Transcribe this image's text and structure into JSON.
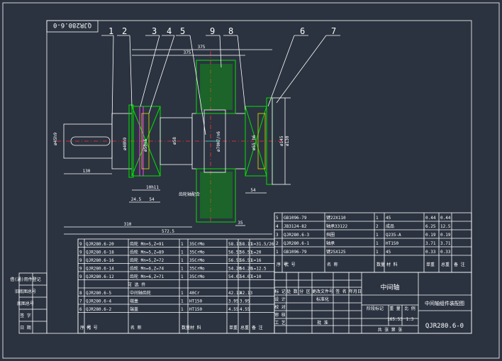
{
  "drawing_code_flipped": "QJR280.6-0",
  "drawing_code": "QJR280.6-0",
  "balloons": [
    "1",
    "2",
    "3",
    "4",
    "5",
    "9",
    "8",
    "6",
    "7"
  ],
  "dimensions": {
    "d_shaft_left": "ø45h9",
    "d_bearing_left": "ø40h9",
    "d_seal_left": "ø50n6",
    "d_journal_left": "ø58",
    "d_gear_bore": "ø70H7/n6",
    "d_bearing_right": "ø55 h6",
    "d_right_1": "ø145",
    "d_right_2": "ø130",
    "len_130": "130",
    "len_24_5": "24.5",
    "len_54": "54",
    "len_10": "10",
    "len_35": "35",
    "len_54b": "54",
    "len_310": "310",
    "len_572_5": "572.5",
    "len_375": "375",
    "len_375b": "375",
    "note_left": "10h11",
    "note_center": "齿轮轴配合"
  },
  "parts_upper": [
    {
      "no": "5",
      "code": "GB1096-79",
      "name": "键22X110",
      "qty": "1",
      "mat": "45",
      "w1": "0.44",
      "w2": "0.44"
    },
    {
      "no": "4",
      "code": "JB3124-82",
      "name": "轴承33122",
      "qty": "2",
      "mat": "成品",
      "w1": "6.25",
      "w2": "12.5"
    },
    {
      "no": "3",
      "code": "QJR280.6-3",
      "name": "挡圈",
      "qty": "1",
      "mat": "Q235-A",
      "w1": "0.19",
      "w2": "0.19"
    },
    {
      "no": "2",
      "code": "QJR280.6-1",
      "name": "轴承",
      "qty": "1",
      "mat": "HT150",
      "w1": "3.71",
      "w2": "3.71"
    },
    {
      "no": "1",
      "code": "GB1096-79",
      "name": "键25X125",
      "qty": "1",
      "mat": "45",
      "w1": "0.33",
      "w2": "0.33"
    }
  ],
  "parts_lower": [
    {
      "no": "9",
      "code": "QJR280.6-20",
      "name": "齿轮 Mn=5,Z=91",
      "qty": "1",
      "mat": "35CrMo",
      "w1": "58.11",
      "w2": "58.11",
      "note": "i=31.5/26"
    },
    {
      "no": "9",
      "code": "QJR280.6-18",
      "name": "齿轮 Mn=5,Z=89",
      "qty": "1",
      "mat": "35CrMo",
      "w1": "56.51",
      "w2": "56.51",
      "note": "i=20"
    },
    {
      "no": "9",
      "code": "QJR280.6-16",
      "name": "齿轮 Mn=5,Z=72",
      "qty": "1",
      "mat": "35CrMo",
      "w1": "56.51",
      "w2": "56.51",
      "note": "i=16"
    },
    {
      "no": "9",
      "code": "QJR280.6-14",
      "name": "齿轮 Mn=6,Z=74",
      "qty": "1",
      "mat": "35CrMo",
      "w1": "54.20",
      "w2": "54.20",
      "note": "i=12.5"
    },
    {
      "no": "9",
      "code": "QJR280.6-12",
      "name": "齿轮 Mn=6,Z=71",
      "qty": "1",
      "mat": "35CrMo",
      "w1": "54.07",
      "w2": "54.07",
      "note": "i=10"
    }
  ],
  "section_label": "可 选 件",
  "parts_bottom": [
    {
      "no": "8",
      "code": "QJR280.6-5",
      "name": "中间轴齿轮",
      "qty": "1",
      "mat": "40Cr",
      "w1": "42.13",
      "w2": "42.13"
    },
    {
      "no": "7",
      "code": "QJR280.6-4",
      "name": "端盖",
      "qty": "1",
      "mat": "HT150",
      "w1": "3.95",
      "w2": "3.95"
    },
    {
      "no": "6",
      "code": "QJR280.6-2",
      "name": "端盖",
      "qty": "1",
      "mat": "HT150",
      "w1": "4.55",
      "w2": "4.55"
    }
  ],
  "header_cols": [
    "序 号",
    "代 号",
    "名 称",
    "数量",
    "材 料",
    "单重",
    "总重",
    "备 注"
  ],
  "left_margin": [
    "借(通)用件登记",
    "旧底图总号",
    "底图总号",
    "签 字",
    "日 期"
  ],
  "title_block": {
    "part_title": "中间轴",
    "assembly_title": "中间轴组件装配图",
    "rows": [
      "标 记",
      "处 数",
      "分 区",
      "更改文件号",
      "签 名",
      "年月日"
    ],
    "roles": [
      "设 计",
      "标准化",
      "校 对",
      "审 核",
      "工 艺",
      "批 准"
    ],
    "stage_label": "阶段标记",
    "weight_label": "重 量",
    "scale_label": "比 例",
    "weight": "165.53",
    "scale": "1:3",
    "sheet": "共 张 第 张"
  }
}
